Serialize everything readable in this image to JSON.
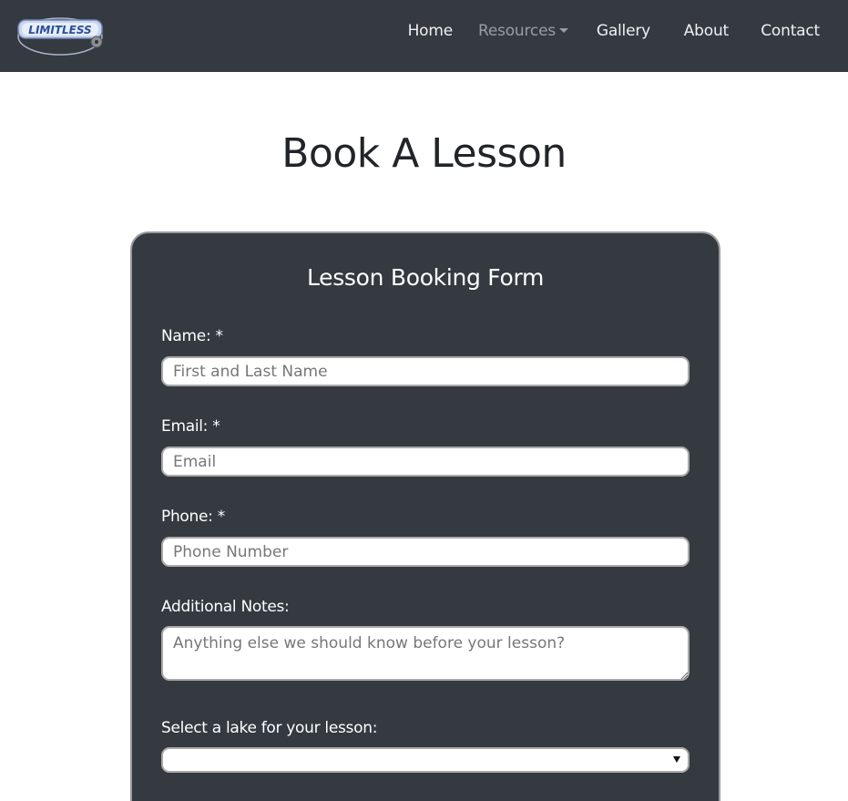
{
  "brand": {
    "logo_text": "LIMITLESS"
  },
  "nav": {
    "home": "Home",
    "resources": "Resources",
    "gallery": "Gallery",
    "about": "About",
    "contact": "Contact"
  },
  "page": {
    "title": "Book A Lesson"
  },
  "form": {
    "title": "Lesson Booking Form",
    "name_label": "Name: *",
    "name_placeholder": "First and Last Name",
    "email_label": "Email: *",
    "email_placeholder": "Email",
    "phone_label": "Phone: *",
    "phone_placeholder": "Phone Number",
    "notes_label": "Additional Notes:",
    "notes_placeholder": "Anything else we should know before your lesson?",
    "lake_label": "Select a lake for your lesson:",
    "lake_value": ""
  },
  "colors": {
    "navbar": "#343a40",
    "card": "#343a40",
    "text": "#212529"
  }
}
